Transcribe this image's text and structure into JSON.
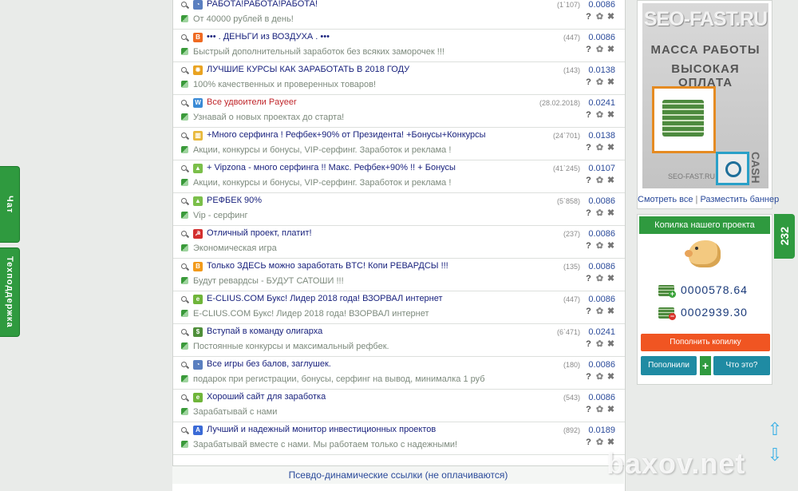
{
  "side_tabs": {
    "chat": "Чат",
    "support": "Техподдержка"
  },
  "rows": [
    {
      "title": "РАБОТА!РАБОТА!РАБОТА!",
      "desc": "От 40000 рублей в день!",
      "count": "(1`107)",
      "price": "0.0086",
      "icon_color": "#5a7fc0",
      "icon_glyph": "◔",
      "title_color": "#1a237e"
    },
    {
      "title": "••• . ДЕНЬГИ из ВОЗДУХА . •••",
      "desc": "Быстрый дополнительный заработок без всяких заморочек !!!",
      "count": "(447)",
      "price": "0.0086",
      "icon_color": "#ef6a22",
      "icon_glyph": "B",
      "title_color": "#1a237e"
    },
    {
      "title": "ЛУЧШИЕ КУРСЫ КАК ЗАРАБОТАТЬ В 2018 ГОДУ",
      "desc": "100% качественных и проверенных товаров!",
      "count": "(143)",
      "price": "0.0138",
      "icon_color": "#e9a321",
      "icon_glyph": "✹",
      "title_color": "#1a237e"
    },
    {
      "title": "Все удвоители Payeer",
      "desc": "Узнавай о новых проектах до старта!",
      "count": "(28.02.2018)",
      "price": "0.0241",
      "icon_color": "#3a8ad6",
      "icon_glyph": "W",
      "title_color": "#c0262b"
    },
    {
      "title": "+Много серфинга ! Рефбек+90% от Президента! +Бонусы+Конкурсы",
      "desc": "Акции, конкурсы и бонусы, VIP-серфинг. Заработок и реклама !",
      "count": "(24`701)",
      "price": "0.0138",
      "icon_color": "#e8b83a",
      "icon_glyph": "▥",
      "title_color": "#1a237e"
    },
    {
      "title": "+ Vipzona - много серфинга !! Макс. Рефбек+90% !! + Бонусы",
      "desc": "Акции, конкурсы и бонусы, VIP-серфинг. Заработок и реклама !",
      "count": "(41`245)",
      "price": "0.0107",
      "icon_color": "#7bbf4a",
      "icon_glyph": "▲",
      "title_color": "#1a237e"
    },
    {
      "title": "РЕФБЕК 90%",
      "desc": "Vip - серфинг",
      "count": "(5`858)",
      "price": "0.0086",
      "icon_color": "#7bbf4a",
      "icon_glyph": "▲",
      "title_color": "#1a237e"
    },
    {
      "title": "Отличный проект, платит!",
      "desc": "Экономическая игра",
      "count": "(237)",
      "price": "0.0086",
      "icon_color": "#d32f2f",
      "icon_glyph": "☭",
      "title_color": "#1a237e"
    },
    {
      "title": "Только ЗДЕСЬ можно заработать BTC! Копи РЕВАРДСЫ !!!",
      "desc": "Будут ревардсы - БУДУТ САТОШИ !!!",
      "count": "(135)",
      "price": "0.0086",
      "icon_color": "#f29a1a",
      "icon_glyph": "B",
      "title_color": "#1a237e"
    },
    {
      "title": "E-CLIUS.COM Букс! Лидер 2018 года! ВЗОРВАЛ интернет",
      "desc": "E-CLIUS.COM Букс! Лидер 2018 года! ВЗОРВАЛ интернет",
      "count": "(447)",
      "price": "0.0086",
      "icon_color": "#6fb53a",
      "icon_glyph": "e",
      "title_color": "#1a237e"
    },
    {
      "title": "Вступай в команду олигарха",
      "desc": "Постоянные конкурсы и максимальный рефбек.",
      "count": "(6`471)",
      "price": "0.0241",
      "icon_color": "#4f8f3a",
      "icon_glyph": "$",
      "title_color": "#1a237e"
    },
    {
      "title": "Все игры без балов, заглушек.",
      "desc": "подарок при регистрации, бонусы, серфинг на вывод, минималка 1 руб",
      "count": "(180)",
      "price": "0.0086",
      "icon_color": "#5a7fc0",
      "icon_glyph": "◔",
      "title_color": "#1a237e"
    },
    {
      "title": "Хороший сайт для заработка",
      "desc": "Зарабатывай с нами",
      "count": "(543)",
      "price": "0.0086",
      "icon_color": "#6fb53a",
      "icon_glyph": "e",
      "title_color": "#1a237e"
    },
    {
      "title": "Лучший и надежный монитор инвестиционных проектов",
      "desc": "Зарабатывай вместе с нами. Мы работаем только с надежными!",
      "count": "(892)",
      "price": "0.0189",
      "icon_color": "#3a6ad6",
      "icon_glyph": "A",
      "title_color": "#1a237e"
    }
  ],
  "pseudo_section": "Псевдо-динамические ссылки (не оплачиваются)",
  "banner": {
    "brand": "SEO-FAST.RU",
    "line1": "МАССА РАБОТЫ",
    "line2": "ВЫСОКАЯ ОПЛАТА",
    "footer": "SEO-FAST.RU",
    "cash": "CASH",
    "link_all": "Смотреть все",
    "sep": "|",
    "link_place": "Разместить баннер"
  },
  "piggy": {
    "header": "Копилка нашего проекта",
    "balance_in": "0000578.64",
    "balance_out": "0002939.30",
    "topup": "Пополнить копилку",
    "deposit": "Пополнили",
    "plus": "+",
    "whatis": "Что это?"
  },
  "online_count": "232",
  "watermark": "baxov.net"
}
